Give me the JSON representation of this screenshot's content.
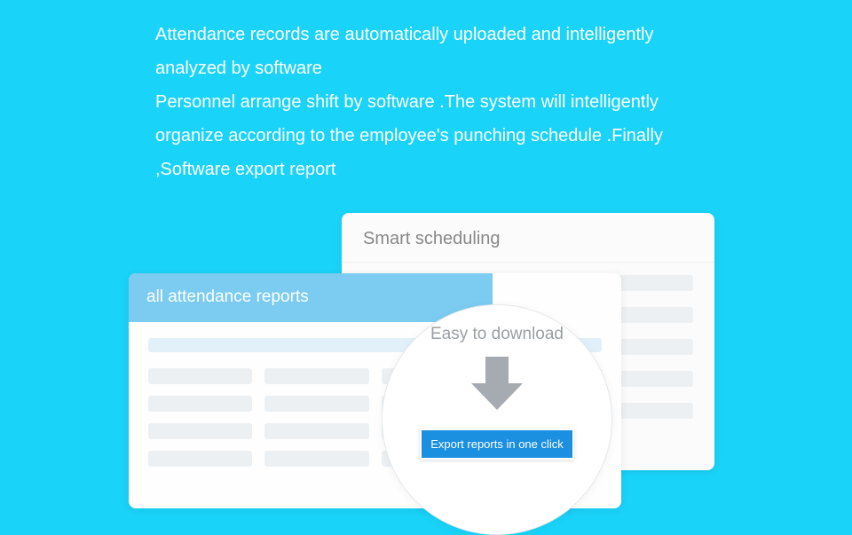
{
  "description": {
    "line1": "Attendance records are automatically uploaded and intelligently analyzed by software",
    "line2": "Personnel arrange shift by software .The system will intelligently organize according to the employee's punching schedule .Finally ,Software export report"
  },
  "backCard": {
    "title": "Smart scheduling"
  },
  "frontCard": {
    "title": "all attendance reports"
  },
  "circle": {
    "title": "Easy to download",
    "buttonLabel": "Export reports in one click"
  },
  "colors": {
    "background": "#1ad3f8",
    "accent": "#7bccf0",
    "buttonBg": "#1b8fe0"
  }
}
